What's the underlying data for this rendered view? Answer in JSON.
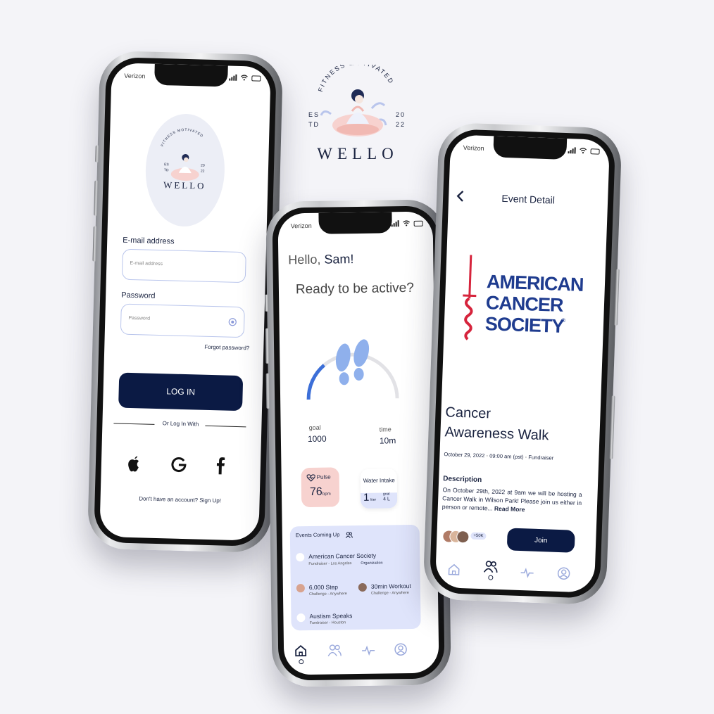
{
  "brand": {
    "arc_text": "FITNESS MOTIVATED",
    "est_left_top": "ES",
    "est_left_bottom": "TD",
    "est_right_top": "20",
    "est_right_bottom": "22",
    "name": "WELLO"
  },
  "status_bar": {
    "carrier": "Verizon"
  },
  "login_screen": {
    "email_label": "E-mail address",
    "email_placeholder": "E-mail address",
    "password_label": "Password",
    "password_placeholder": "Password",
    "forgot_password": "Forgot password?",
    "login_button": "LOG IN",
    "or_login_with": "Or Log In With",
    "signup_prompt": "Don't have an account? Sign Up!"
  },
  "home_screen": {
    "greeting_prefix": "Hello,",
    "greeting_name": "Sam!",
    "subtitle": "Ready to be active?",
    "goal_label": "goal",
    "goal_value": "1000",
    "time_label": "time",
    "time_value": "10m",
    "step_progress": 0.28,
    "pulse": {
      "label": "Pulse",
      "value": "76",
      "unit": "bpm"
    },
    "water": {
      "label": "Water Intake",
      "value": "1",
      "unit": "liter",
      "goal_label": "goal",
      "goal_value": "4 L"
    },
    "events_title": "Events Coming Up",
    "events": [
      {
        "title": "American Cancer Society",
        "sub": "Fundraiser - Los Angeles",
        "tag": "Organization"
      },
      {
        "title": "6,000 Step",
        "sub": "Challenge - Anywhere"
      },
      {
        "title": "30min Workout",
        "sub": "Challenge - Anywhere"
      },
      {
        "title": "Austism Speaks",
        "sub": "Fundraiser - Houston"
      }
    ]
  },
  "event_screen": {
    "header": "Event Detail",
    "org_logo_line1": "AMERICAN",
    "org_logo_line2": "CANCER",
    "org_logo_line3": "SOCIETY",
    "org_logo_mark": "®",
    "title_line1": "Cancer",
    "title_line2": "Awareness Walk",
    "meta_date": "October 29, 2022",
    "meta_time": "09:00 am (pst)",
    "meta_type": "Fundraiser",
    "description_heading": "Description",
    "description": "On October 29th, 2022 at 9am we will be hosting a Cancer Walk in Wilson Park! Please join us either in person or remote...",
    "read_more": "Read More",
    "attendees_count": "+50K",
    "join_button": "Join"
  },
  "colors": {
    "navy": "#0b1a44",
    "accent_blue": "#3c6fd8",
    "pulse_bg": "#f7d2cf",
    "events_bg": "#dfe4fb",
    "acs_blue": "#1f3c8f",
    "acs_red": "#d6243c"
  }
}
